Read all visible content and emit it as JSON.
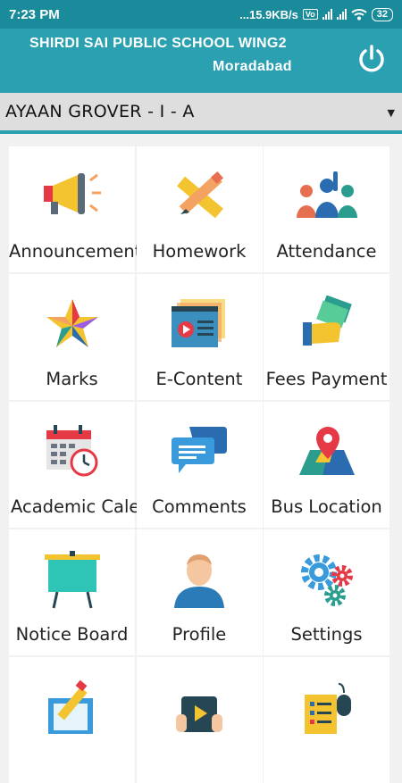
{
  "status_bar": {
    "time": "7:23 PM",
    "speed": "...15.9KB/s",
    "volte": "Vo",
    "battery": "32"
  },
  "header": {
    "title": "SHIRDI SAI PUBLIC SCHOOL WING2",
    "subtitle": "Moradabad",
    "power_icon": "power-icon"
  },
  "student": {
    "selected": "AYAAN GROVER - I - A",
    "caret": "▼"
  },
  "tiles": [
    {
      "label": "Announcement",
      "icon": "megaphone-icon"
    },
    {
      "label": "Homework",
      "icon": "pencil-ruler-icon"
    },
    {
      "label": "Attendance",
      "icon": "students-hand-raise-icon"
    },
    {
      "label": "Marks",
      "icon": "star-icon"
    },
    {
      "label": "E-Content",
      "icon": "video-content-icon"
    },
    {
      "label": "Fees Payment",
      "icon": "cash-hand-icon"
    },
    {
      "label": "Academic Calendar",
      "icon": "calendar-clock-icon"
    },
    {
      "label": "Comments",
      "icon": "chat-bubbles-icon"
    },
    {
      "label": "Bus Location",
      "icon": "map-pin-icon"
    },
    {
      "label": "Notice Board",
      "icon": "board-icon"
    },
    {
      "label": "Profile",
      "icon": "person-icon"
    },
    {
      "label": "Settings",
      "icon": "gears-icon"
    },
    {
      "label": "",
      "icon": "note-pencil-icon"
    },
    {
      "label": "",
      "icon": "video-player-icon"
    },
    {
      "label": "",
      "icon": "checklist-mouse-icon"
    }
  ],
  "colors": {
    "status_bar": "#1a8b9a",
    "header": "#2aa0b0",
    "select_bg": "#dedede"
  }
}
